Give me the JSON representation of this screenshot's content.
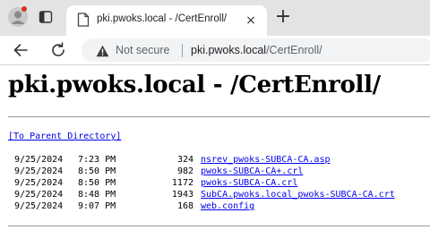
{
  "browser": {
    "tab": {
      "title": "pki.pwoks.local - /CertEnroll/"
    },
    "new_tab_label": "+",
    "close_label": "×",
    "address": {
      "security_label": "Not secure",
      "host": "pki.pwoks.local",
      "path": "/CertEnroll/"
    }
  },
  "page": {
    "heading": "pki.pwoks.local - /CertEnroll/",
    "parent_link": "[To Parent Directory]",
    "files": [
      {
        "date": "9/25/2024",
        "time": "7:23 PM",
        "size": "324",
        "name": "nsrev_pwoks-SUBCA-CA.asp"
      },
      {
        "date": "9/25/2024",
        "time": "8:50 PM",
        "size": "982",
        "name": "pwoks-SUBCA-CA+.crl"
      },
      {
        "date": "9/25/2024",
        "time": "8:50 PM",
        "size": "1172",
        "name": "pwoks-SUBCA-CA.crl"
      },
      {
        "date": "9/25/2024",
        "time": "8:48 PM",
        "size": "1943",
        "name": "SubCA.pwoks.local_pwoks-SUBCA-CA.crt"
      },
      {
        "date": "9/25/2024",
        "time": "9:07 PM",
        "size": "168",
        "name": "web.config"
      }
    ]
  },
  "icons": {
    "profile": "profile-avatar-icon",
    "workspaces": "workspaces-icon",
    "favicon": "page-favicon-icon",
    "back": "back-arrow-icon",
    "reload": "reload-icon",
    "warning": "warning-triangle-icon"
  },
  "colors": {
    "link": "#0000ee",
    "tabstrip": "#e3e3e3",
    "omnibox": "#f1f3f4",
    "notification_dot": "#d93025"
  }
}
